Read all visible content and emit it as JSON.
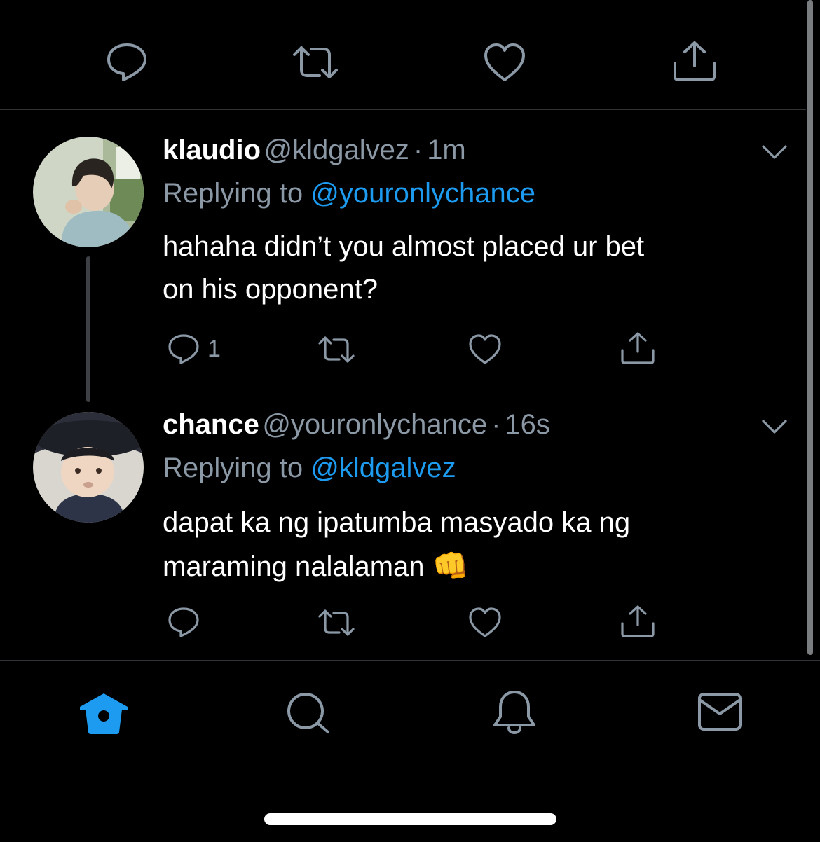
{
  "top_action_bar": {
    "reply_icon": "reply-icon",
    "retweet_icon": "retweet-icon",
    "like_icon": "heart-icon",
    "share_icon": "share-icon"
  },
  "tweets": [
    {
      "display_name": "klaudio",
      "handle": "@kldgalvez",
      "separator": "·",
      "time": "1m",
      "replying_prefix": "Replying to",
      "replying_to": "@youronlychance",
      "text_line1": "hahaha didn’t you almost placed ur bet",
      "text_line2": "on his opponent?",
      "reply_count": "1"
    },
    {
      "display_name": "chance",
      "handle": "@youronlychance",
      "separator": "·",
      "time": "16s",
      "replying_prefix": "Replying to",
      "replying_to": "@kldgalvez",
      "text_line1": "dapat ka ng ipatumba masyado ka ng",
      "text_line2": "maraming nalalaman",
      "emoji": "👊"
    }
  ],
  "tab_bar": {
    "items": [
      "home-icon",
      "search-icon",
      "notifications-icon",
      "messages-icon"
    ],
    "active": "home",
    "accent": "#1d9bf0"
  },
  "colors": {
    "background": "#000000",
    "secondary_text": "#8b98a5",
    "link": "#1d9bf0",
    "divider": "#2f3336"
  }
}
